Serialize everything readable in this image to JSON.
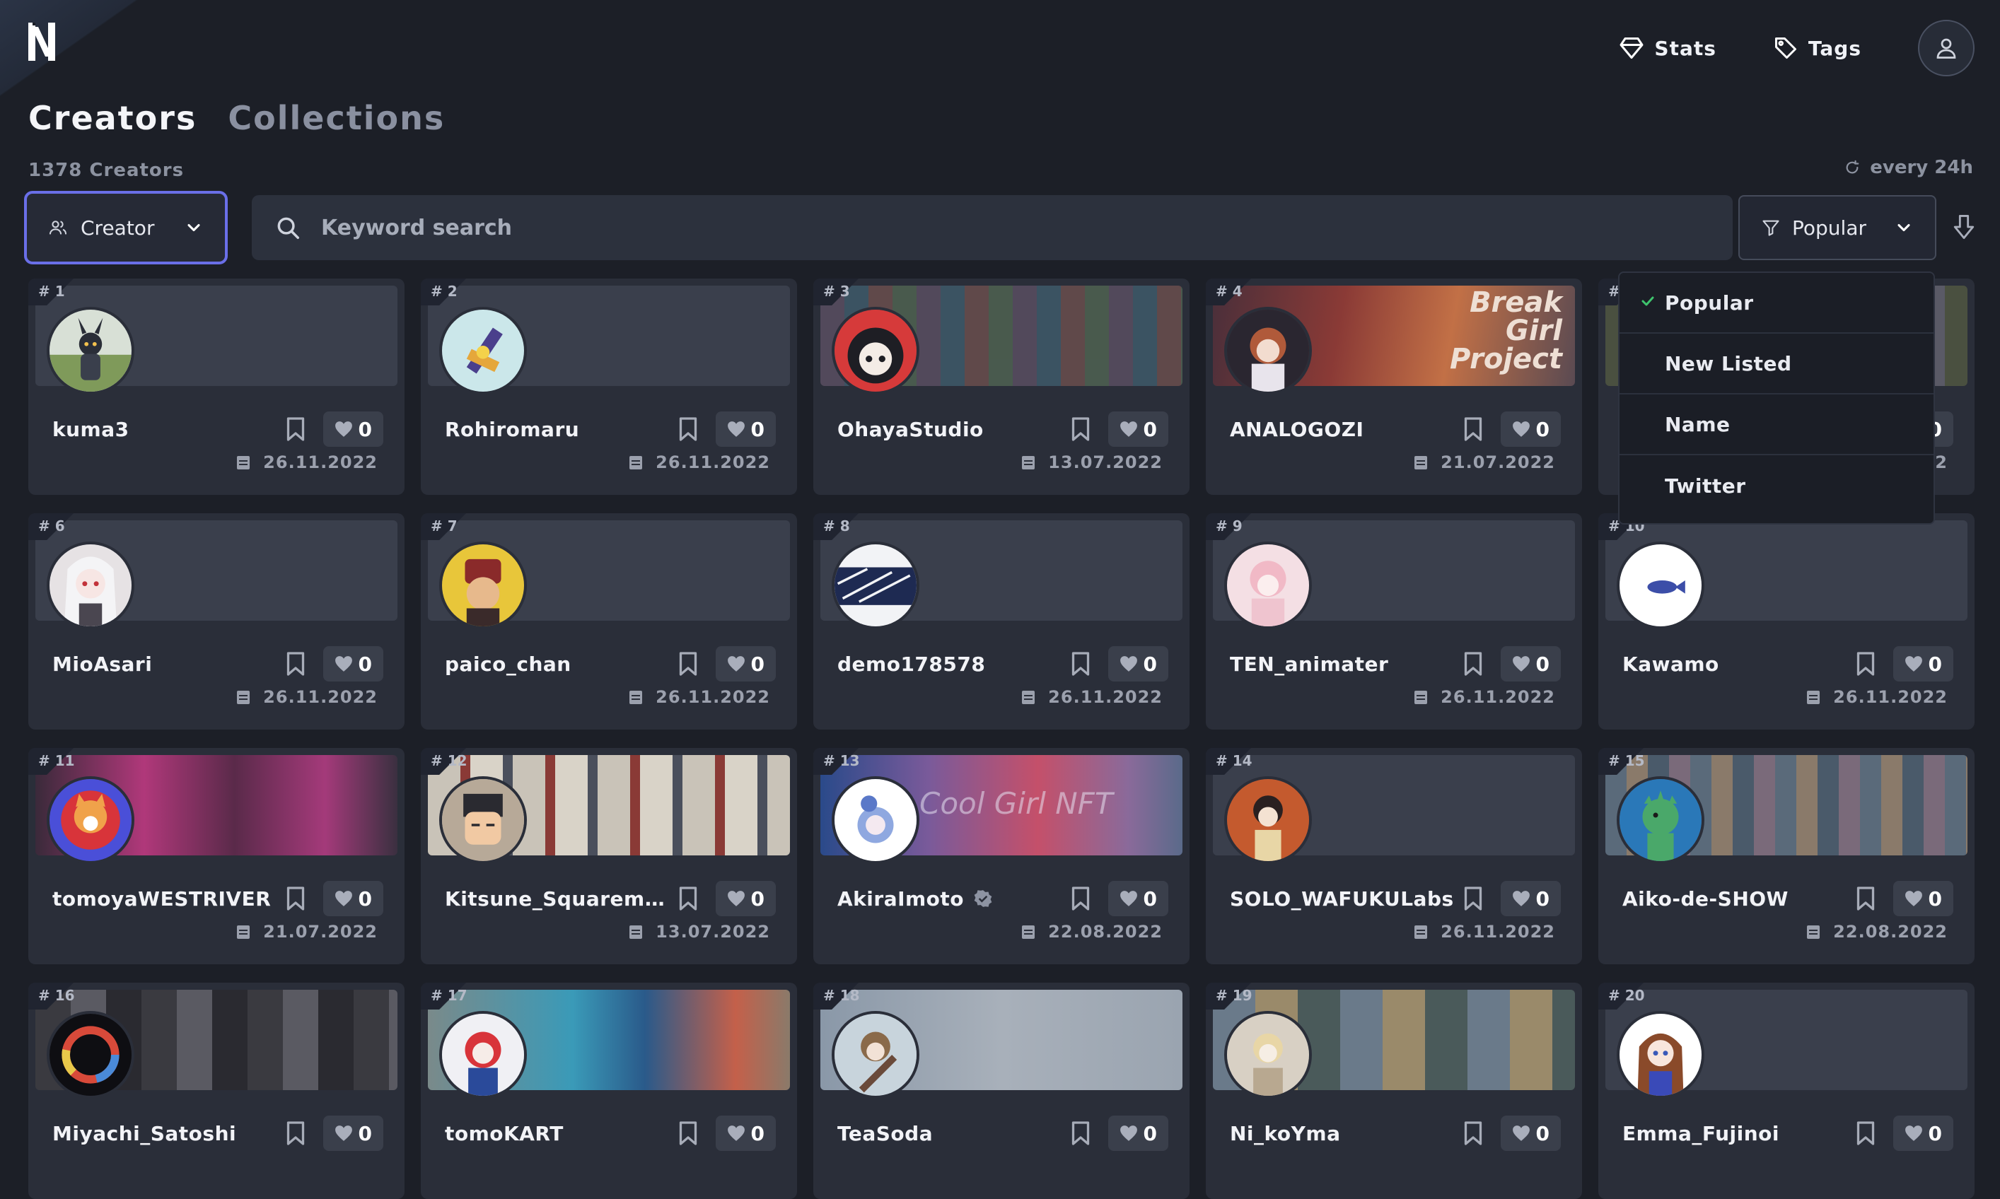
{
  "header": {
    "nav": [
      {
        "label": "Stats",
        "icon": "stats-icon"
      },
      {
        "label": "Tags",
        "icon": "tag-icon"
      }
    ],
    "account_icon": "user-icon"
  },
  "tabs": [
    {
      "label": "Creators",
      "active": true
    },
    {
      "label": "Collections",
      "active": false
    }
  ],
  "count_label": "1378 Creators",
  "refresh_label": "every 24h",
  "filter": {
    "type_label": "Creator",
    "search_placeholder": "Keyword search",
    "sort_label": "Popular"
  },
  "sort_options": [
    {
      "label": "Popular",
      "selected": true
    },
    {
      "label": "New Listed",
      "selected": false
    },
    {
      "label": "Name",
      "selected": false
    },
    {
      "label": "Twitter",
      "selected": false
    }
  ],
  "cards": [
    {
      "rank": "# 1",
      "name": "kuma3",
      "likes": "0",
      "date": "26.11.2022"
    },
    {
      "rank": "# 2",
      "name": "Rohiromaru",
      "likes": "0",
      "date": "26.11.2022"
    },
    {
      "rank": "# 3",
      "name": "OhayaStudio",
      "likes": "0",
      "date": "13.07.2022"
    },
    {
      "rank": "# 4",
      "name": "ANALOGOZI",
      "likes": "0",
      "date": "21.07.2022"
    },
    {
      "rank": "#",
      "name": "",
      "likes": "0",
      "date": "22"
    },
    {
      "rank": "# 6",
      "name": "MioAsari",
      "likes": "0",
      "date": "26.11.2022"
    },
    {
      "rank": "# 7",
      "name": "paico_chan",
      "likes": "0",
      "date": "26.11.2022"
    },
    {
      "rank": "# 8",
      "name": "demo178578",
      "likes": "0",
      "date": "26.11.2022"
    },
    {
      "rank": "# 9",
      "name": "TEN_animater",
      "likes": "0",
      "date": "26.11.2022"
    },
    {
      "rank": "# 10",
      "name": "Kawamo",
      "likes": "0",
      "date": "26.11.2022"
    },
    {
      "rank": "# 11",
      "name": "tomoyaWESTRIVER",
      "likes": "0",
      "date": "21.07.2022"
    },
    {
      "rank": "# 12",
      "name": "Kitsune_Squarema...",
      "likes": "0",
      "date": "13.07.2022"
    },
    {
      "rank": "# 13",
      "name": "AkiraImoto",
      "likes": "0",
      "date": "22.08.2022",
      "verified": true
    },
    {
      "rank": "# 14",
      "name": "SOLO_WAFUKULabs",
      "likes": "0",
      "date": "26.11.2022"
    },
    {
      "rank": "# 15",
      "name": "Aiko-de-SHOW",
      "likes": "0",
      "date": "22.08.2022"
    },
    {
      "rank": "# 16",
      "name": "Miyachi_Satoshi",
      "likes": "0",
      "date": ""
    },
    {
      "rank": "# 17",
      "name": "tomoKART",
      "likes": "0",
      "date": ""
    },
    {
      "rank": "# 18",
      "name": "TeaSoda",
      "likes": "0",
      "date": ""
    },
    {
      "rank": "# 19",
      "name": "Ni_koYma",
      "likes": "0",
      "date": ""
    },
    {
      "rank": "# 20",
      "name": "Emma_Fujinoi",
      "likes": "0",
      "date": ""
    }
  ],
  "banner_text": {
    "card4": [
      "Break",
      "Girl",
      "Project"
    ],
    "card13": "Cool Girl NFT"
  }
}
